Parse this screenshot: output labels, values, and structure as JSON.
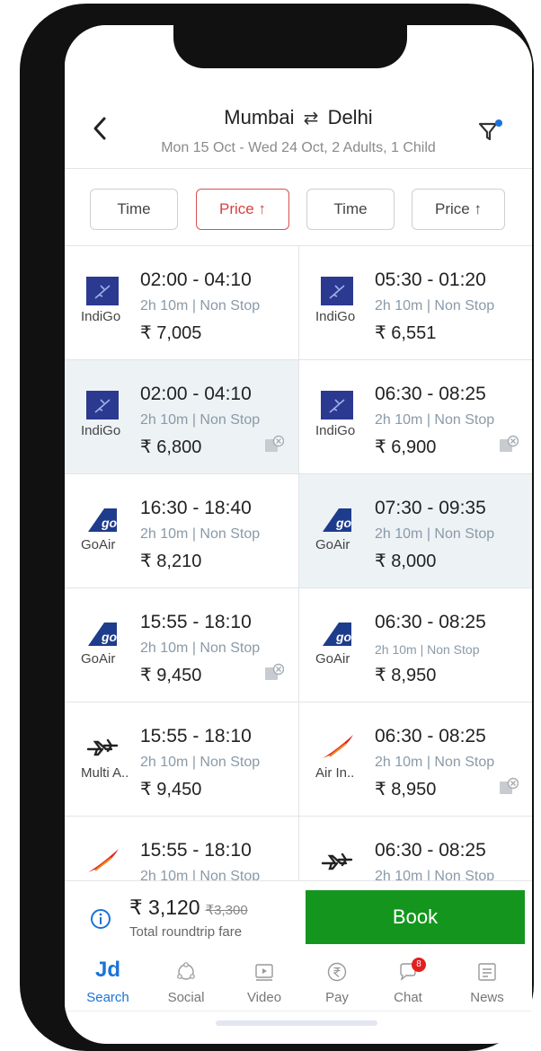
{
  "header": {
    "origin": "Mumbai",
    "swap_icon": "⇄",
    "destination": "Delhi",
    "subtitle": "Mon 15 Oct - Wed 24 Oct, 2 Adults, 1 Child"
  },
  "sort": {
    "left_time": "Time",
    "left_price": "Price ↑",
    "right_time": "Time",
    "right_price": "Price ↑"
  },
  "outbound": [
    {
      "airline": "IndiGo",
      "logo": "indigo-logo",
      "times": "02:00 - 04:10",
      "duration": "2h 10m | Non Stop",
      "price": "₹ 7,005",
      "meal_icon": false,
      "selected": false
    },
    {
      "airline": "IndiGo",
      "logo": "indigo-logo",
      "times": "02:00 - 04:10",
      "duration": "2h 10m | Non Stop",
      "price": "₹ 6,800",
      "meal_icon": true,
      "selected": true
    },
    {
      "airline": "GoAir",
      "logo": "goair-logo",
      "times": "16:30 - 18:40",
      "duration": "2h 10m | Non Stop",
      "price": "₹ 8,210",
      "meal_icon": false,
      "selected": false
    },
    {
      "airline": "GoAir",
      "logo": "goair-logo",
      "times": "15:55 - 18:10",
      "duration": "2h 10m | Non Stop",
      "price": "₹ 9,450",
      "meal_icon": true,
      "selected": false
    },
    {
      "airline": "Multi A..",
      "logo": "multi-airline-logo",
      "times": "15:55 - 18:10",
      "duration": "2h 10m | Non Stop",
      "price": "₹ 9,450",
      "meal_icon": false,
      "selected": false
    },
    {
      "airline": "",
      "logo": "air-india-logo",
      "times": "15:55 - 18:10",
      "duration": "2h 10m | Non Stop",
      "price": "",
      "meal_icon": false,
      "selected": false
    }
  ],
  "return": [
    {
      "airline": "IndiGo",
      "logo": "indigo-logo",
      "times": "05:30 - 01:20",
      "duration": "2h 10m | Non Stop",
      "price": "₹ 6,551",
      "meal_icon": false,
      "selected": false
    },
    {
      "airline": "IndiGo",
      "logo": "indigo-logo",
      "times": "06:30 - 08:25",
      "duration": "2h 10m | Non Stop",
      "price": "₹ 6,900",
      "meal_icon": true,
      "selected": false
    },
    {
      "airline": "GoAir",
      "logo": "goair-logo",
      "times": "07:30 - 09:35",
      "duration": "2h 10m | Non Stop",
      "price": "₹ 8,000",
      "meal_icon": false,
      "selected": true
    },
    {
      "airline": "GoAir",
      "logo": "goair-logo",
      "times": "06:30 - 08:25",
      "duration": "2h 10m | Non Stop",
      "price": "₹ 8,950",
      "meal_icon": false,
      "selected": false
    },
    {
      "airline": "Air In..",
      "logo": "air-india-logo",
      "times": "06:30 - 08:25",
      "duration": "2h 10m | Non Stop",
      "price": "₹ 8,950",
      "meal_icon": true,
      "selected": false
    },
    {
      "airline": "",
      "logo": "multi-airline-logo",
      "times": "06:30 - 08:25",
      "duration": "2h 10m | Non Stop",
      "price": "",
      "meal_icon": false,
      "selected": false
    }
  ],
  "footer": {
    "fare": "₹ 3,120",
    "old_fare": "₹3,300",
    "fare_label": "Total roundtrip fare",
    "book_label": "Book"
  },
  "tabs": [
    {
      "label": "Search",
      "icon": "jd-logo",
      "active": true
    },
    {
      "label": "Social",
      "icon": "social-icon",
      "active": false
    },
    {
      "label": "Video",
      "icon": "video-icon",
      "active": false
    },
    {
      "label": "Pay",
      "icon": "rupee-icon",
      "active": false
    },
    {
      "label": "Chat",
      "icon": "chat-icon",
      "active": false,
      "badge": "8"
    },
    {
      "label": "News",
      "icon": "news-icon",
      "active": false
    }
  ],
  "jd_logo_text": "Jd",
  "colors": {
    "accent": "#1a73d8",
    "book": "#14961e",
    "sort_active": "#d94040",
    "indigo": "#2b3990",
    "goair": "#1e3c8c",
    "airindia": "#e2231a",
    "selected_row": "#edf2f5"
  }
}
